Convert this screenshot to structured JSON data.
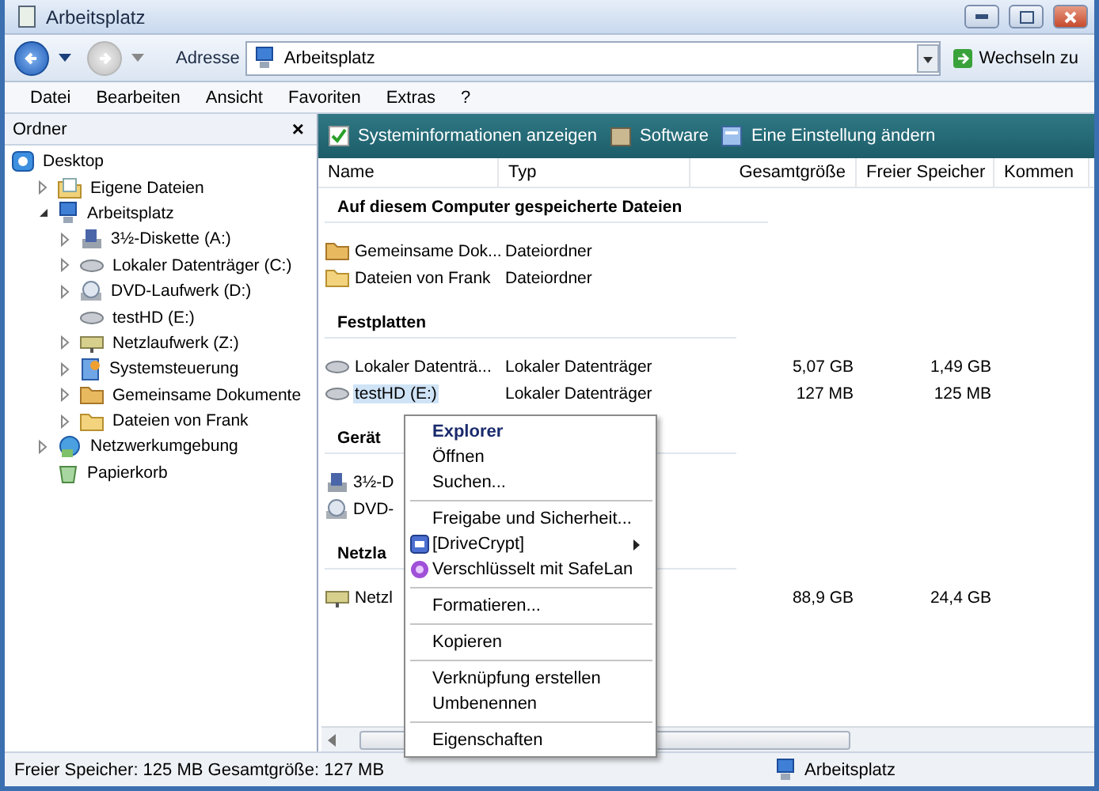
{
  "window": {
    "title": "Arbeitsplatz"
  },
  "navigation": {
    "back": {
      "disabled": false
    },
    "forward": {
      "disabled": true
    }
  },
  "address": {
    "label": "Adresse",
    "value": "Arbeitsplatz",
    "go_button": "Wechseln zu"
  },
  "menu_bar": [
    "Datei",
    "Bearbeiten",
    "Ansicht",
    "Favoriten",
    "Extras",
    "?"
  ],
  "folder_pane": {
    "title": "Ordner",
    "close": "×",
    "tree": [
      {
        "label": "Desktop",
        "kind": "desktop",
        "toggle": false,
        "children": [
          {
            "label": "Eigene Dateien",
            "kind": "documents",
            "toggle": true,
            "expanded": false
          },
          {
            "label": "Arbeitsplatz",
            "kind": "computer",
            "toggle": true,
            "expanded": true,
            "children": [
              {
                "label": "3½-Diskette (A:)",
                "kind": "floppy",
                "toggle": true,
                "expanded": false
              },
              {
                "label": "Lokaler Datenträger (C:)",
                "kind": "drive",
                "toggle": true,
                "expanded": false
              },
              {
                "label": "DVD-Laufwerk (D:)",
                "kind": "dvd",
                "toggle": true,
                "expanded": false
              },
              {
                "label": "testHD (E:)",
                "kind": "drive",
                "toggle": false
              },
              {
                "label": "Netzlaufwerk (Z:)",
                "kind": "netdrive",
                "toggle": true,
                "expanded": false
              },
              {
                "label": "Systemsteuerung",
                "kind": "control",
                "toggle": true,
                "expanded": false
              },
              {
                "label": "Gemeinsame Dokumente",
                "kind": "sharedfolder",
                "toggle": true,
                "expanded": false
              },
              {
                "label": "Dateien von Frank",
                "kind": "folder",
                "toggle": true,
                "expanded": false
              }
            ]
          },
          {
            "label": "Netzwerkumgebung",
            "kind": "network",
            "toggle": true,
            "expanded": false
          },
          {
            "label": "Papierkorb",
            "kind": "recycle",
            "toggle": false
          }
        ]
      }
    ]
  },
  "task_bar": [
    {
      "label": "Systeminformationen anzeigen",
      "kind": "check"
    },
    {
      "label": "Software",
      "kind": "software"
    },
    {
      "label": "Eine Einstellung ändern",
      "kind": "settings"
    }
  ],
  "table": {
    "columns": [
      "Name",
      "Typ",
      "Gesamtgröße",
      "Freier Speicher",
      "Kommen"
    ],
    "rows": [
      {
        "kind": "group",
        "label": "Auf diesem Computer gespeicherte Dateien"
      },
      {
        "kind": "sharedfolder",
        "selected": false,
        "cells": [
          "Gemeinsame Dok...",
          "Dateiordner",
          "",
          ""
        ]
      },
      {
        "kind": "folder",
        "selected": false,
        "cells": [
          "Dateien von Frank",
          "Dateiordner",
          "",
          ""
        ]
      },
      {
        "kind": "group",
        "label": "Festplatten"
      },
      {
        "kind": "drive",
        "selected": false,
        "cells": [
          "Lokaler Datenträ...",
          "Lokaler Datenträger",
          "5,07 GB",
          "1,49 GB"
        ]
      },
      {
        "kind": "drive",
        "selected": true,
        "cells": [
          "testHD (E:)",
          "Lokaler Datenträger",
          "127 MB",
          "125 MB"
        ]
      },
      {
        "kind": "group",
        "label": "Gerät"
      },
      {
        "kind": "floppy",
        "selected": false,
        "cells": [
          "3½-D",
          "",
          "",
          ""
        ]
      },
      {
        "kind": "dvd",
        "selected": false,
        "cells": [
          "DVD-",
          "",
          "",
          ""
        ]
      },
      {
        "kind": "group",
        "label": "Netzla"
      },
      {
        "kind": "netdrive",
        "selected": false,
        "cells": [
          "Netzl",
          "",
          "88,9 GB",
          "24,4 GB"
        ]
      }
    ]
  },
  "context_menu": [
    {
      "kind": "item",
      "label": "Explorer",
      "bold": true,
      "submenu": false
    },
    {
      "kind": "item",
      "label": "Öffnen",
      "bold": false,
      "submenu": false
    },
    {
      "kind": "item",
      "label": "Suchen...",
      "bold": false,
      "submenu": false
    },
    {
      "kind": "separator"
    },
    {
      "kind": "item",
      "label": "Freigabe und Sicherheit...",
      "bold": false,
      "submenu": false
    },
    {
      "kind": "diskitem",
      "label": "[DriveCrypt]",
      "bold": false,
      "submenu": true
    },
    {
      "kind": "badgeitem",
      "label": "Verschlüsselt mit SafeLan",
      "bold": false,
      "submenu": false
    },
    {
      "kind": "separator"
    },
    {
      "kind": "item",
      "label": "Formatieren...",
      "bold": false,
      "submenu": false
    },
    {
      "kind": "separator"
    },
    {
      "kind": "item",
      "label": "Kopieren",
      "bold": false,
      "submenu": false
    },
    {
      "kind": "separator"
    },
    {
      "kind": "item",
      "label": "Verknüpfung erstellen",
      "bold": false,
      "submenu": false
    },
    {
      "kind": "item",
      "label": "Umbenennen",
      "bold": false,
      "submenu": false
    },
    {
      "kind": "separator"
    },
    {
      "kind": "item",
      "label": "Eigenschaften",
      "bold": false,
      "submenu": false
    }
  ],
  "status_bar": {
    "text": "Freier Speicher: 125 MB Gesamtgröße: 127 MB",
    "location": "Arbeitsplatz"
  }
}
